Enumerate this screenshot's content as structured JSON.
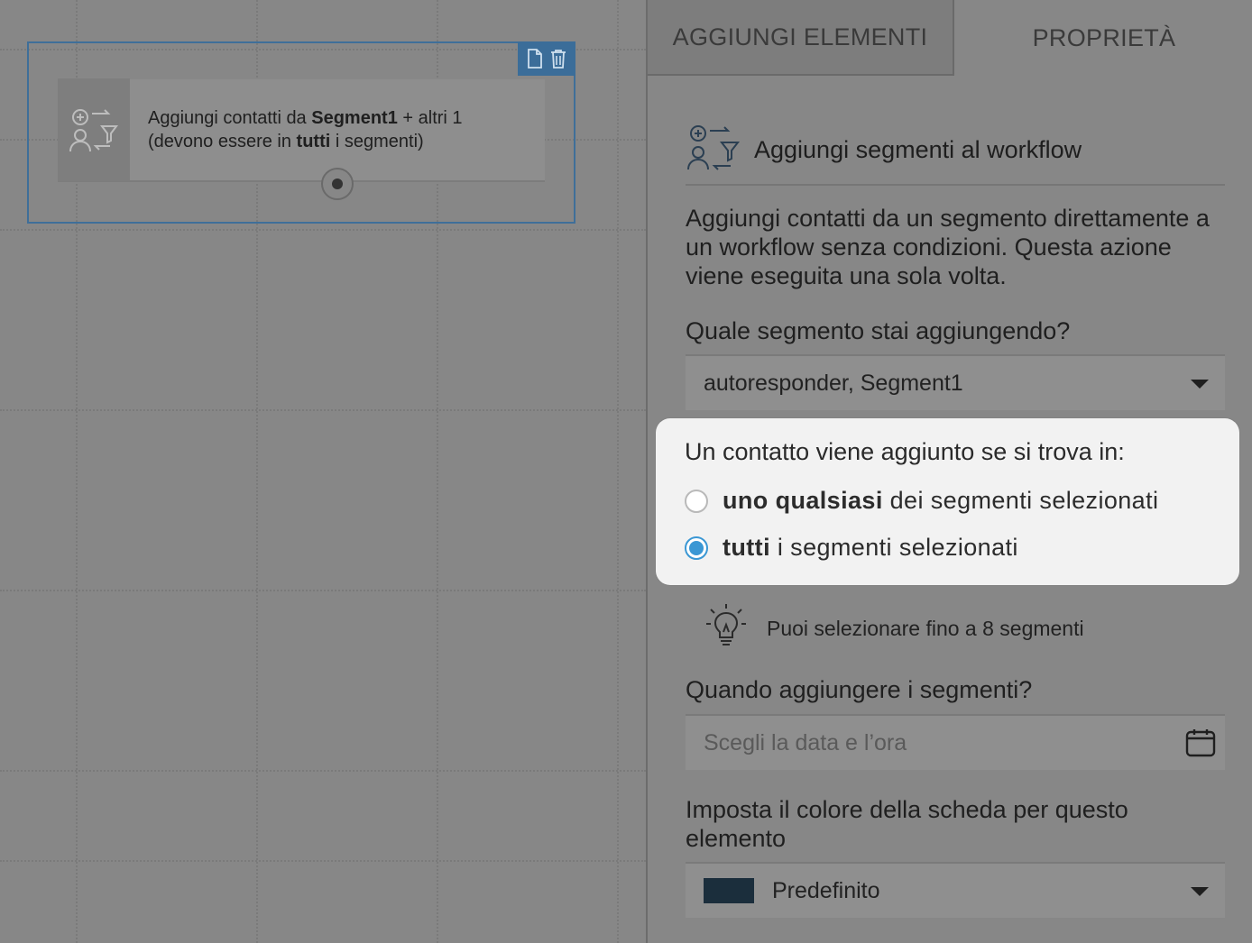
{
  "tabs": {
    "add_elements": "AGGIUNGI ELEMENTI",
    "properties": "PROPRIETÀ"
  },
  "canvas": {
    "node": {
      "line1_prefix": "Aggiungi contatti da ",
      "line1_segment": "Segment1",
      "line1_suffix": " + altri 1",
      "line2_prefix": "(devono essere in ",
      "line2_bold": "tutti",
      "line2_suffix": " i segmenti)",
      "icon": "segment-add-icon",
      "actions": [
        "copy-icon",
        "trash-icon"
      ]
    }
  },
  "panel": {
    "header_title": "Aggiungi segmenti al workflow",
    "header_icon": "segment-add-icon",
    "description": "Aggiungi contatti da un segmento direttamente a un workflow senza condizioni. Questa azione viene eseguita una sola volta.",
    "segment_question": "Quale segmento stai aggiungendo?",
    "segment_value": "autoresponder, Segment1",
    "match_card": {
      "title": "Un contatto viene aggiunto se si trova in:",
      "option_any_bold": "uno qualsiasi",
      "option_any_rest": " dei segmenti selezionati",
      "option_all_bold": "tutti",
      "option_all_rest": " i segmenti selezionati",
      "selected": "all"
    },
    "hint_text": "Puoi selezionare fino a 8 segmenti",
    "when_question": "Quando aggiungere i segmenti?",
    "date_placeholder": "Scegli la data e l’ora",
    "color_question_line1": "Imposta il colore della scheda per questo",
    "color_question_line2": "elemento",
    "color_value": "Predefinito",
    "color_swatch": "#1b2e3c"
  },
  "colors": {
    "accent_blue": "#3a97d4",
    "node_border": "#3f6f99",
    "overlay_gray": "#878787"
  }
}
